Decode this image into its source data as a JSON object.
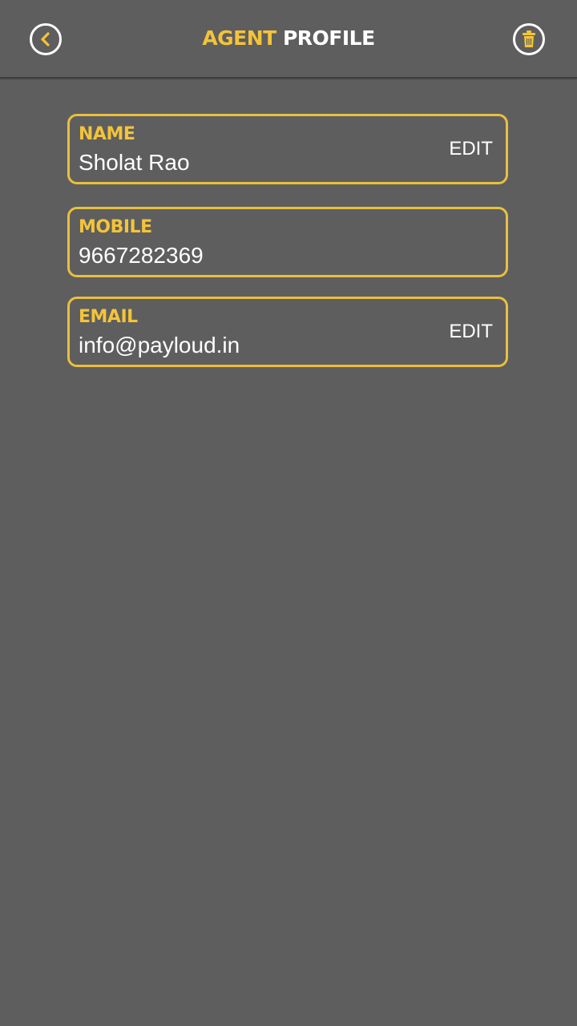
{
  "header": {
    "title_part1": "AGENT",
    "title_part2": "PROFILE",
    "back_icon": "chevron-left-circle-icon",
    "delete_icon": "trash-icon"
  },
  "colors": {
    "background": "#5e5e5e",
    "accent": "#f3c43a",
    "border": "#e9bf3f",
    "text": "#ffffff"
  },
  "fields": [
    {
      "label": "NAME",
      "value": "Sholat Rao",
      "action": "EDIT"
    },
    {
      "label": "MOBILE",
      "value": "9667282369"
    },
    {
      "label": "EMAIL",
      "value": "info@payloud.in",
      "action": "EDIT"
    }
  ]
}
